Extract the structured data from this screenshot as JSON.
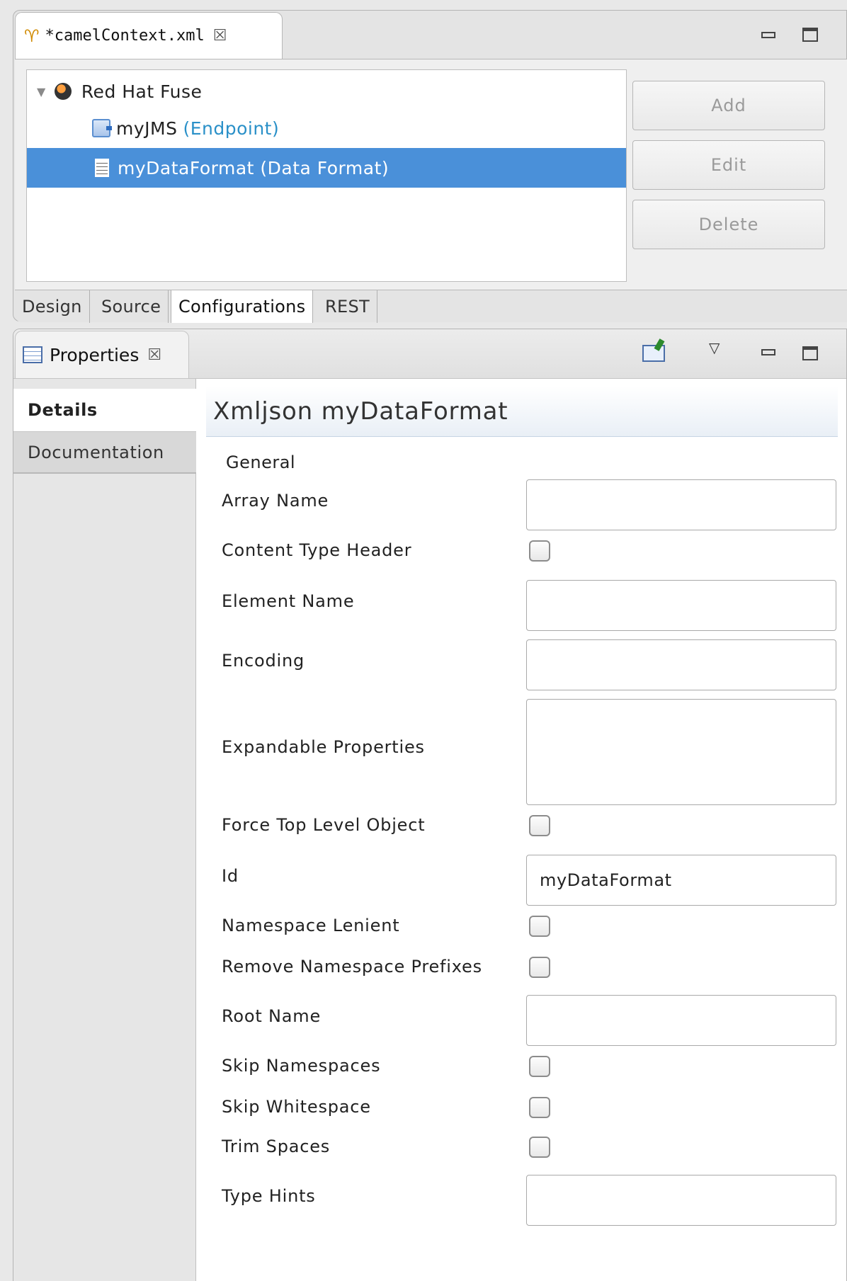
{
  "editor": {
    "tab_label": "*camelContext.xml",
    "close_glyph": "☒",
    "tree": {
      "root": "Red Hat Fuse",
      "items": [
        {
          "name": "myJMS",
          "kind": "(Endpoint)"
        },
        {
          "name": "myDataFormat (Data Format)"
        }
      ]
    },
    "buttons": {
      "add": "Add",
      "edit": "Edit",
      "delete": "Delete"
    },
    "bottom_tabs": [
      "Design",
      "Source",
      "Configurations",
      "REST"
    ]
  },
  "properties": {
    "tab_label": "Properties",
    "close_glyph": "☒",
    "side_tabs": [
      "Details",
      "Documentation"
    ],
    "title": "Xmljson myDataFormat",
    "section": "General",
    "fields": {
      "array_name": {
        "label": "Array Name",
        "value": ""
      },
      "content_type_header": {
        "label": "Content Type Header",
        "checked": false
      },
      "element_name": {
        "label": "Element Name",
        "value": ""
      },
      "encoding": {
        "label": "Encoding",
        "value": ""
      },
      "expandable_properties": {
        "label": "Expandable Properties",
        "value": ""
      },
      "force_top_level_object": {
        "label": "Force Top Level Object",
        "checked": false
      },
      "id": {
        "label": "Id",
        "value": "myDataFormat"
      },
      "namespace_lenient": {
        "label": "Namespace Lenient",
        "checked": false
      },
      "remove_namespace_prefixes": {
        "label": "Remove Namespace Prefixes",
        "checked": false
      },
      "root_name": {
        "label": "Root Name",
        "value": ""
      },
      "skip_namespaces": {
        "label": "Skip Namespaces",
        "checked": false
      },
      "skip_whitespace": {
        "label": "Skip Whitespace",
        "checked": false
      },
      "trim_spaces": {
        "label": "Trim Spaces",
        "checked": false
      },
      "type_hints": {
        "label": "Type Hints",
        "value": ""
      }
    }
  },
  "colors": {
    "selection": "#4a90d9",
    "link": "#2a90c8"
  }
}
